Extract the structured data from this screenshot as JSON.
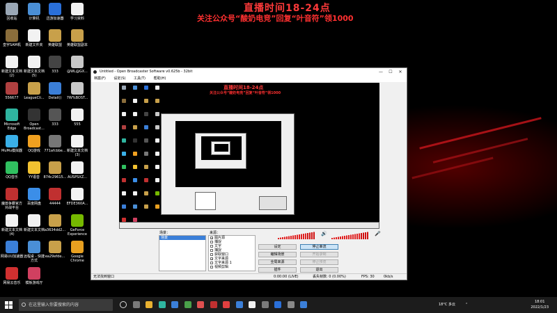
{
  "overlay": {
    "title": "直播时间18-24点",
    "subtitle": "关注公众号“酸奶电竞”回复“叶音符”领1000"
  },
  "desktop_icons": [
    {
      "label": "回收站",
      "icon": "recycle-bin-icon",
      "color": "#9aa7b5"
    },
    {
      "label": "计算机",
      "icon": "computer-icon",
      "color": "#4a8fd6"
    },
    {
      "label": "迅游加速器",
      "icon": "xunyou-icon",
      "color": "#2a6fd8"
    },
    {
      "label": "学习资料",
      "icon": "document-icon",
      "color": "#f2f2f2"
    },
    {
      "label": "皇宇SAM机",
      "icon": "app-icon",
      "color": "#8a6d3b"
    },
    {
      "label": "新建文件夹",
      "icon": "document-icon",
      "color": "#f2f2f2"
    },
    {
      "label": "英雄联盟",
      "icon": "lol-icon",
      "color": "#c8a04a"
    },
    {
      "label": "英雄联盟副本",
      "icon": "lol-icon",
      "color": "#c8a04a"
    },
    {
      "label": "新建文本文档(2)",
      "icon": "document-icon",
      "color": "#f2f2f2"
    },
    {
      "label": "新建文本文档(5)",
      "icon": "document-icon",
      "color": "#f2f2f2"
    },
    {
      "label": "333",
      "icon": "app-icon",
      "color": "#444"
    },
    {
      "label": "@WL@GX...",
      "icon": "app-icon",
      "color": "#c8c8c8"
    },
    {
      "label": "556677",
      "icon": "app-icon",
      "color": "#b04040"
    },
    {
      "label": "LeagueCli...",
      "icon": "lol-icon",
      "color": "#c8a04a"
    },
    {
      "label": "Detail()",
      "icon": "app-icon",
      "color": "#3b7fd8"
    },
    {
      "label": "7W%BOST...",
      "icon": "app-icon",
      "color": "#c8c8c8"
    },
    {
      "label": "Microsoft Edge",
      "icon": "edge-icon",
      "color": "#2fb5a0"
    },
    {
      "label": "Open Broadcast...",
      "icon": "obs-icon",
      "color": "#333"
    },
    {
      "label": "333",
      "icon": "app-icon",
      "color": "#555"
    },
    {
      "label": "555",
      "icon": "document-icon",
      "color": "#f2f2f2"
    },
    {
      "label": "MuMu模拟器",
      "icon": "mumu-icon",
      "color": "#3ab0e8"
    },
    {
      "label": "QQ游戏",
      "icon": "qqgame-icon",
      "color": "#f0a020"
    },
    {
      "label": "771afcbbe...",
      "icon": "app-icon",
      "color": "#777"
    },
    {
      "label": "新建文本文档(3)",
      "icon": "document-icon",
      "color": "#f2f2f2"
    },
    {
      "label": "QQ音乐",
      "icon": "qqmusic-icon",
      "color": "#30c060"
    },
    {
      "label": "YY语音",
      "icon": "yy-icon",
      "color": "#f2c230"
    },
    {
      "label": "874c29615...",
      "icon": "app-icon",
      "color": "#c8a04a"
    },
    {
      "label": "AUSPSXZ...",
      "icon": "document-icon",
      "color": "#f2f2f2"
    },
    {
      "label": "魔兽争霸官方对战平台",
      "icon": "warcraft-icon",
      "color": "#c03030"
    },
    {
      "label": "百度网盘",
      "icon": "baidu-icon",
      "color": "#3b8ee8"
    },
    {
      "label": "44444",
      "icon": "app-icon",
      "color": "#c03030"
    },
    {
      "label": "EFDE360A...",
      "icon": "document-icon",
      "color": "#f2f2f2"
    },
    {
      "label": "新建文本文档(4)",
      "icon": "document-icon",
      "color": "#f2f2f2"
    },
    {
      "label": "新建文本文档",
      "icon": "document-icon",
      "color": "#f2f2f2"
    },
    {
      "label": "a3634dd2...",
      "icon": "app-icon",
      "color": "#c8a04a"
    },
    {
      "label": "GeForce Experience",
      "icon": "nvidia-icon",
      "color": "#76b900"
    },
    {
      "label": "网易UU加速器",
      "icon": "uu-icon",
      "color": "#3b7fd8"
    },
    {
      "label": "远程桌 - 快捷方式",
      "icon": "remote-icon",
      "color": "#4a8fd6"
    },
    {
      "label": "ea29efde...",
      "icon": "app-icon",
      "color": "#c8a04a"
    },
    {
      "label": "Google Chrome",
      "icon": "chrome-icon",
      "color": "#e8a020"
    },
    {
      "label": "网易云音乐",
      "icon": "netease-icon",
      "color": "#d03030"
    },
    {
      "label": "模板游戏厅",
      "icon": "app-icon",
      "color": "#d04060"
    }
  ],
  "obs": {
    "title": "Untitled - Open Broadcaster Software v0.625b - 32bit",
    "menu": [
      "档案(F)",
      "设定(S)",
      "工具(T)",
      "帮助(H)"
    ],
    "scenes_label": "场景：",
    "scenes": [
      "场景"
    ],
    "sources_label": "来源：",
    "sources": [
      {
        "label": "图片源",
        "checked": true
      },
      {
        "label": "捕捉",
        "checked": false
      },
      {
        "label": "文字",
        "checked": false
      },
      {
        "label": "捕捉",
        "checked": false
      },
      {
        "label": "获取窗口",
        "checked": false
      },
      {
        "label": "文字来源",
        "checked": true
      },
      {
        "label": "文字来源 1",
        "checked": false
      },
      {
        "label": "视频剪辑",
        "checked": false
      }
    ],
    "buttons": {
      "settings": "设定",
      "stop_stream": "停止串流",
      "edit_scene": "编辑场景",
      "global_sources": "全局来源",
      "plugins": "插件",
      "exit": "退出",
      "start_recording": "开始录制",
      "preview": "停止预览"
    },
    "status": {
      "left": "无法找到窗口",
      "time": "0:00:00 (LIVE)",
      "dropped": "丢失帧数: 0 (0.00%)",
      "fps": "FPS: 30",
      "bitrate": "0kb/s"
    }
  },
  "taskbar": {
    "search_placeholder": "在这里输入你要搜索的内容",
    "weather": "18°C 多云",
    "time": "18:01",
    "date": "2022/1/23"
  }
}
